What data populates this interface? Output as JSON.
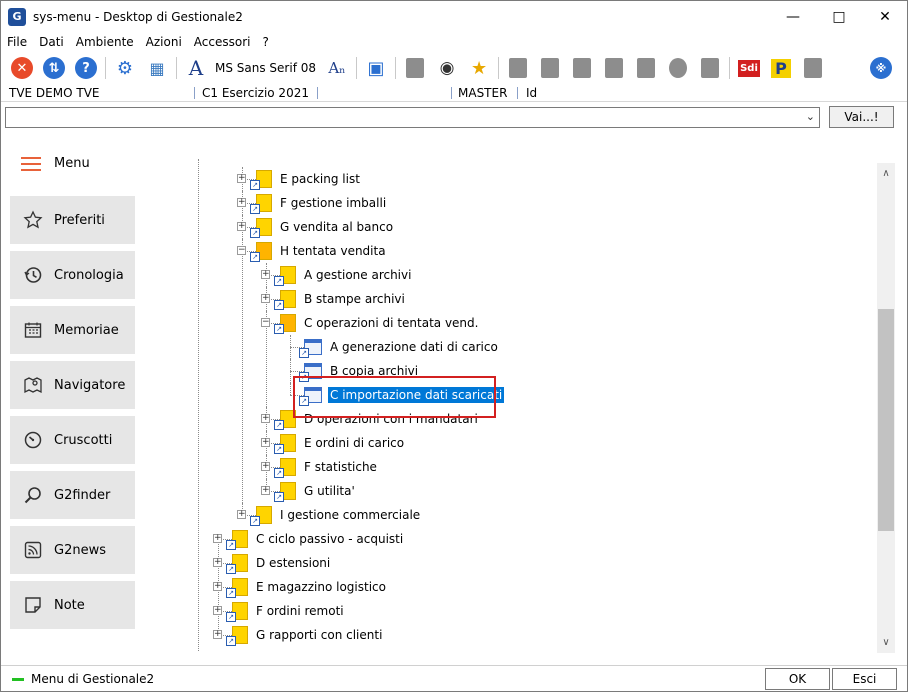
{
  "window": {
    "title": "sys-menu - Desktop di Gestionale2",
    "app_icon_letter": "G"
  },
  "menubar": [
    "File",
    "Dati",
    "Ambiente",
    "Azioni",
    "Accessori",
    "?"
  ],
  "toolbar": {
    "font_name": "MS Sans Serif 08",
    "sdi_label": "Sdi",
    "p_label": "P"
  },
  "infobar": {
    "company": "TVE DEMO TVE",
    "year": "C1 Esercizio 2021",
    "user": "MASTER",
    "id": "Id"
  },
  "command": {
    "value": "",
    "button": "Vai...!"
  },
  "sidebar": {
    "menu_label": "Menu",
    "items": [
      {
        "label": "Preferiti"
      },
      {
        "label": "Cronologia"
      },
      {
        "label": "Memoriae"
      },
      {
        "label": "Navigatore"
      },
      {
        "label": "Cruscotti"
      },
      {
        "label": "G2finder"
      },
      {
        "label": "G2news"
      },
      {
        "label": "Note"
      }
    ]
  },
  "tree": [
    {
      "label": "E packing list",
      "depth": 1,
      "type": "folder",
      "state": "collapsed"
    },
    {
      "label": "F gestione imballi",
      "depth": 1,
      "type": "folder",
      "state": "collapsed"
    },
    {
      "label": "G vendita al banco",
      "depth": 1,
      "type": "folder",
      "state": "collapsed"
    },
    {
      "label": "H tentata vendita",
      "depth": 1,
      "type": "folder",
      "state": "expanded"
    },
    {
      "label": "A gestione archivi",
      "depth": 2,
      "type": "folder",
      "state": "collapsed"
    },
    {
      "label": "B stampe archivi",
      "depth": 2,
      "type": "folder",
      "state": "collapsed"
    },
    {
      "label": "C operazioni di tentata vend.",
      "depth": 2,
      "type": "folder",
      "state": "expanded"
    },
    {
      "label": "A generazione dati di carico",
      "depth": 3,
      "type": "program",
      "state": "leaf"
    },
    {
      "label": "B copia archivi",
      "depth": 3,
      "type": "program",
      "state": "leaf"
    },
    {
      "label": "C importazione dati scaricati",
      "depth": 3,
      "type": "program",
      "state": "selected"
    },
    {
      "label": "D operazioni con i mandatari",
      "depth": 2,
      "type": "folder",
      "state": "collapsed"
    },
    {
      "label": "E ordini di carico",
      "depth": 2,
      "type": "folder",
      "state": "collapsed"
    },
    {
      "label": "F statistiche",
      "depth": 2,
      "type": "folder",
      "state": "collapsed"
    },
    {
      "label": "G utilita'",
      "depth": 2,
      "type": "folder",
      "state": "collapsed"
    },
    {
      "label": "I gestione commerciale",
      "depth": 1,
      "type": "folder",
      "state": "collapsed"
    },
    {
      "label": "C ciclo passivo - acquisti",
      "depth": 0,
      "type": "folder",
      "state": "collapsed"
    },
    {
      "label": "D estensioni",
      "depth": 0,
      "type": "folder",
      "state": "collapsed"
    },
    {
      "label": "E magazzino logistico",
      "depth": 0,
      "type": "folder",
      "state": "collapsed"
    },
    {
      "label": "F ordini remoti",
      "depth": 0,
      "type": "folder",
      "state": "collapsed"
    },
    {
      "label": "G rapporti con clienti",
      "depth": 0,
      "type": "folder",
      "state": "collapsed"
    }
  ],
  "status": {
    "text": "Menu di Gestionale2",
    "ok": "OK",
    "cancel": "Esci"
  },
  "colors": {
    "accent": "#0078d7",
    "folder": "#ffd400",
    "highlight_box": "#d32020",
    "menu_icon": "#e8623a",
    "status_led": "#22c022"
  }
}
